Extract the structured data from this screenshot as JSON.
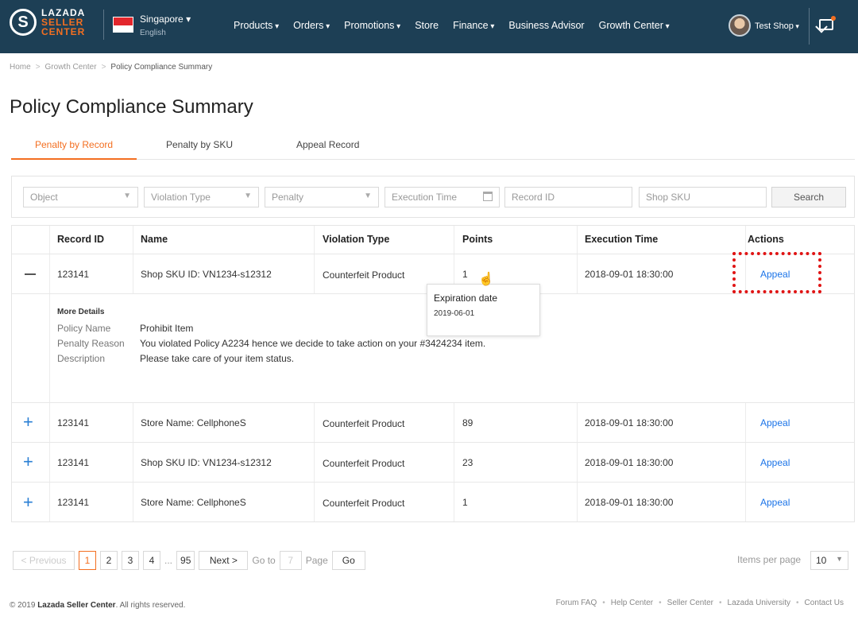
{
  "header": {
    "logo_letter": "S",
    "logo_lines": [
      "LAZADA",
      "SELLER",
      "CENTER"
    ],
    "country": "Singapore",
    "language": "English",
    "nav": [
      {
        "label": "Products",
        "dropdown": true
      },
      {
        "label": "Orders",
        "dropdown": true
      },
      {
        "label": "Promotions",
        "dropdown": true
      },
      {
        "label": "Store",
        "dropdown": false
      },
      {
        "label": "Finance",
        "dropdown": true
      },
      {
        "label": "Business Advisor",
        "dropdown": false
      },
      {
        "label": "Growth Center",
        "dropdown": true
      }
    ],
    "shop_name": "Test Shop",
    "colors": {
      "bar": "#1d3f55",
      "accent": "#f36f21"
    }
  },
  "breadcrumb": [
    "Home",
    "Growth Center",
    "Policy Compliance Summary"
  ],
  "page_title": "Policy Compliance Summary",
  "tabs": [
    "Penalty by Record",
    "Penalty by SKU",
    "Appeal Record"
  ],
  "filters": {
    "object": "Object",
    "violation_type": "Violation Type",
    "penalty": "Penalty",
    "execution_time": "Execution Time",
    "record_id": "Record ID",
    "shop_sku": "Shop SKU",
    "search": "Search"
  },
  "table": {
    "headers": [
      "Record ID",
      "Name",
      "Violation Type",
      "Points",
      "Execution Time",
      "Actions"
    ],
    "rows": [
      {
        "record_id": "123141",
        "name": "Shop SKU ID: VN1234-s12312",
        "violation": "Counterfeit Product",
        "points": "1",
        "time": "2018-09-01 18:30:00",
        "action": "Appeal"
      },
      {
        "record_id": "123141",
        "name": "Store Name: CellphoneS",
        "violation": "Counterfeit Product",
        "points": "89",
        "time": "2018-09-01 18:30:00",
        "action": "Appeal"
      },
      {
        "record_id": "123141",
        "name": "Shop SKU ID: VN1234-s12312",
        "violation": "Counterfeit Product",
        "points": "23",
        "time": "2018-09-01 18:30:00",
        "action": "Appeal"
      },
      {
        "record_id": "123141",
        "name": "Store Name: CellphoneS",
        "violation": "Counterfeit Product",
        "points": "1",
        "time": "2018-09-01 18:30:00",
        "action": "Appeal"
      }
    ],
    "details": {
      "heading": "More Details",
      "items": [
        {
          "key": "Policy Name",
          "value": "Prohibit Item"
        },
        {
          "key": "Penalty Reason",
          "value": "You violated Policy A2234 hence we decide to take action on your #3424234 item."
        },
        {
          "key": "Description",
          "value": "Please take care of your item status."
        }
      ]
    },
    "tooltip": {
      "title": "Expiration date",
      "date": "2019-06-01"
    }
  },
  "pagination": {
    "previous": "< Previous",
    "pages": [
      "1",
      "2",
      "3",
      "4"
    ],
    "ellipsis": "...",
    "last": "95",
    "next": "Next >",
    "goto_label": "Go to",
    "goto_value": "7",
    "page_label": "Page",
    "go": "Go",
    "items_per_page_label": "Items per page",
    "items_per_page": "10"
  },
  "footer": {
    "copyright_prefix": "© 2019",
    "copyright_brand": "Lazada Seller Center",
    "copyright_suffix": ". All rights reserved.",
    "links": [
      "Forum FAQ",
      "Help Center",
      "Seller Center",
      "Lazada University",
      "Contact Us"
    ]
  }
}
